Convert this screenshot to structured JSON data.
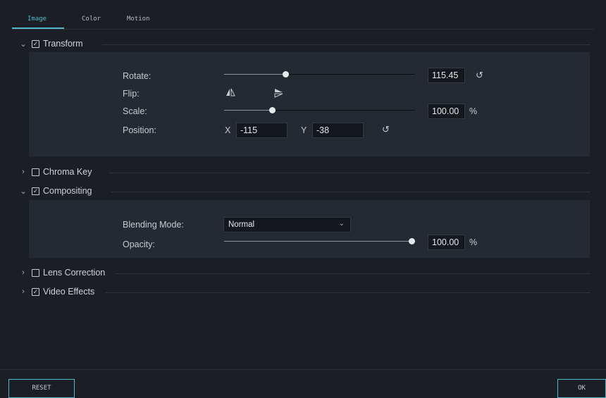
{
  "tabs": [
    {
      "label": "Image",
      "active": true
    },
    {
      "label": "Color",
      "active": false
    },
    {
      "label": "Motion",
      "active": false
    }
  ],
  "sections": {
    "transform": {
      "label": "Transform",
      "expanded": true,
      "checked": true
    },
    "chroma_key": {
      "label": "Chroma Key",
      "expanded": false,
      "checked": false
    },
    "compositing": {
      "label": "Compositing",
      "expanded": true,
      "checked": true
    },
    "lens_correction": {
      "label": "Lens Correction",
      "expanded": false,
      "checked": false
    },
    "video_effects": {
      "label": "Video Effects",
      "expanded": false,
      "checked": true
    }
  },
  "transform": {
    "rotate": {
      "label": "Rotate:",
      "value": "115.45",
      "slider_fraction": 0.32
    },
    "flip": {
      "label": "Flip:",
      "icons": [
        "flip-horizontal-icon",
        "flip-vertical-icon"
      ]
    },
    "scale": {
      "label": "Scale:",
      "value": "100.00",
      "unit": "%",
      "slider_fraction": 0.25
    },
    "position": {
      "label": "Position:",
      "x_label": "X",
      "x_value": "-115",
      "y_label": "Y",
      "y_value": "-38"
    }
  },
  "compositing": {
    "blending_mode": {
      "label": "Blending Mode:",
      "value": "Normal"
    },
    "opacity": {
      "label": "Opacity:",
      "value": "100.00",
      "unit": "%",
      "slider_fraction": 1.0
    }
  },
  "icons": {
    "expanded": "chevron-down-icon",
    "collapsed": "chevron-right-icon",
    "checkbox": "checkbox-icon",
    "reset": "reset-icon"
  },
  "buttons": {
    "reset": "RESET",
    "ok": "OK"
  },
  "colors": {
    "accent": "#4fb9c7",
    "background": "#1b1f25",
    "panel": "#242a31"
  }
}
